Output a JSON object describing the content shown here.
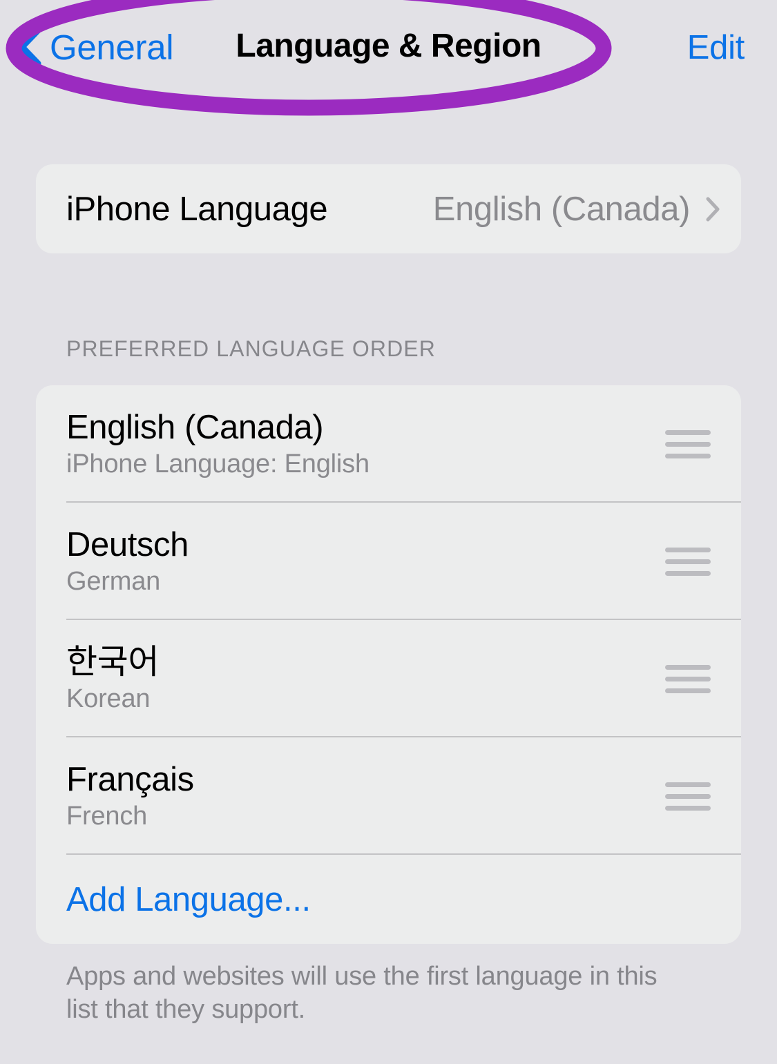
{
  "colors": {
    "background": "#e2e1e6",
    "card": "#eceded",
    "accent_blue": "#0b72e7",
    "secondary_text": "#8a8a8e",
    "separator": "#c3c3c5",
    "annotation_purple": "#9b2bc0",
    "handle_gray": "#bcbcc0"
  },
  "nav": {
    "back_label": "General",
    "title": "Language & Region",
    "edit_label": "Edit",
    "back_icon": "chevron-left-icon"
  },
  "annotation": {
    "shape": "ellipse",
    "color": "#9b2bc0",
    "stroke_width": 22,
    "target": "nav-bar"
  },
  "language_row": {
    "label": "iPhone Language",
    "value": "English (Canada)",
    "disclosure_icon": "chevron-right-icon"
  },
  "section": {
    "header": "PREFERRED LANGUAGE ORDER"
  },
  "languages": [
    {
      "title": "English (Canada)",
      "subtitle": "iPhone Language: English",
      "handle_icon": "reorder-handle-icon"
    },
    {
      "title": "Deutsch",
      "subtitle": "German",
      "handle_icon": "reorder-handle-icon"
    },
    {
      "title": "한국어",
      "subtitle": "Korean",
      "handle_icon": "reorder-handle-icon"
    },
    {
      "title": "Français",
      "subtitle": "French",
      "handle_icon": "reorder-handle-icon"
    }
  ],
  "add_language": {
    "label": "Add Language..."
  },
  "footer": {
    "note": "Apps and websites will use the first language in this list that they support."
  }
}
